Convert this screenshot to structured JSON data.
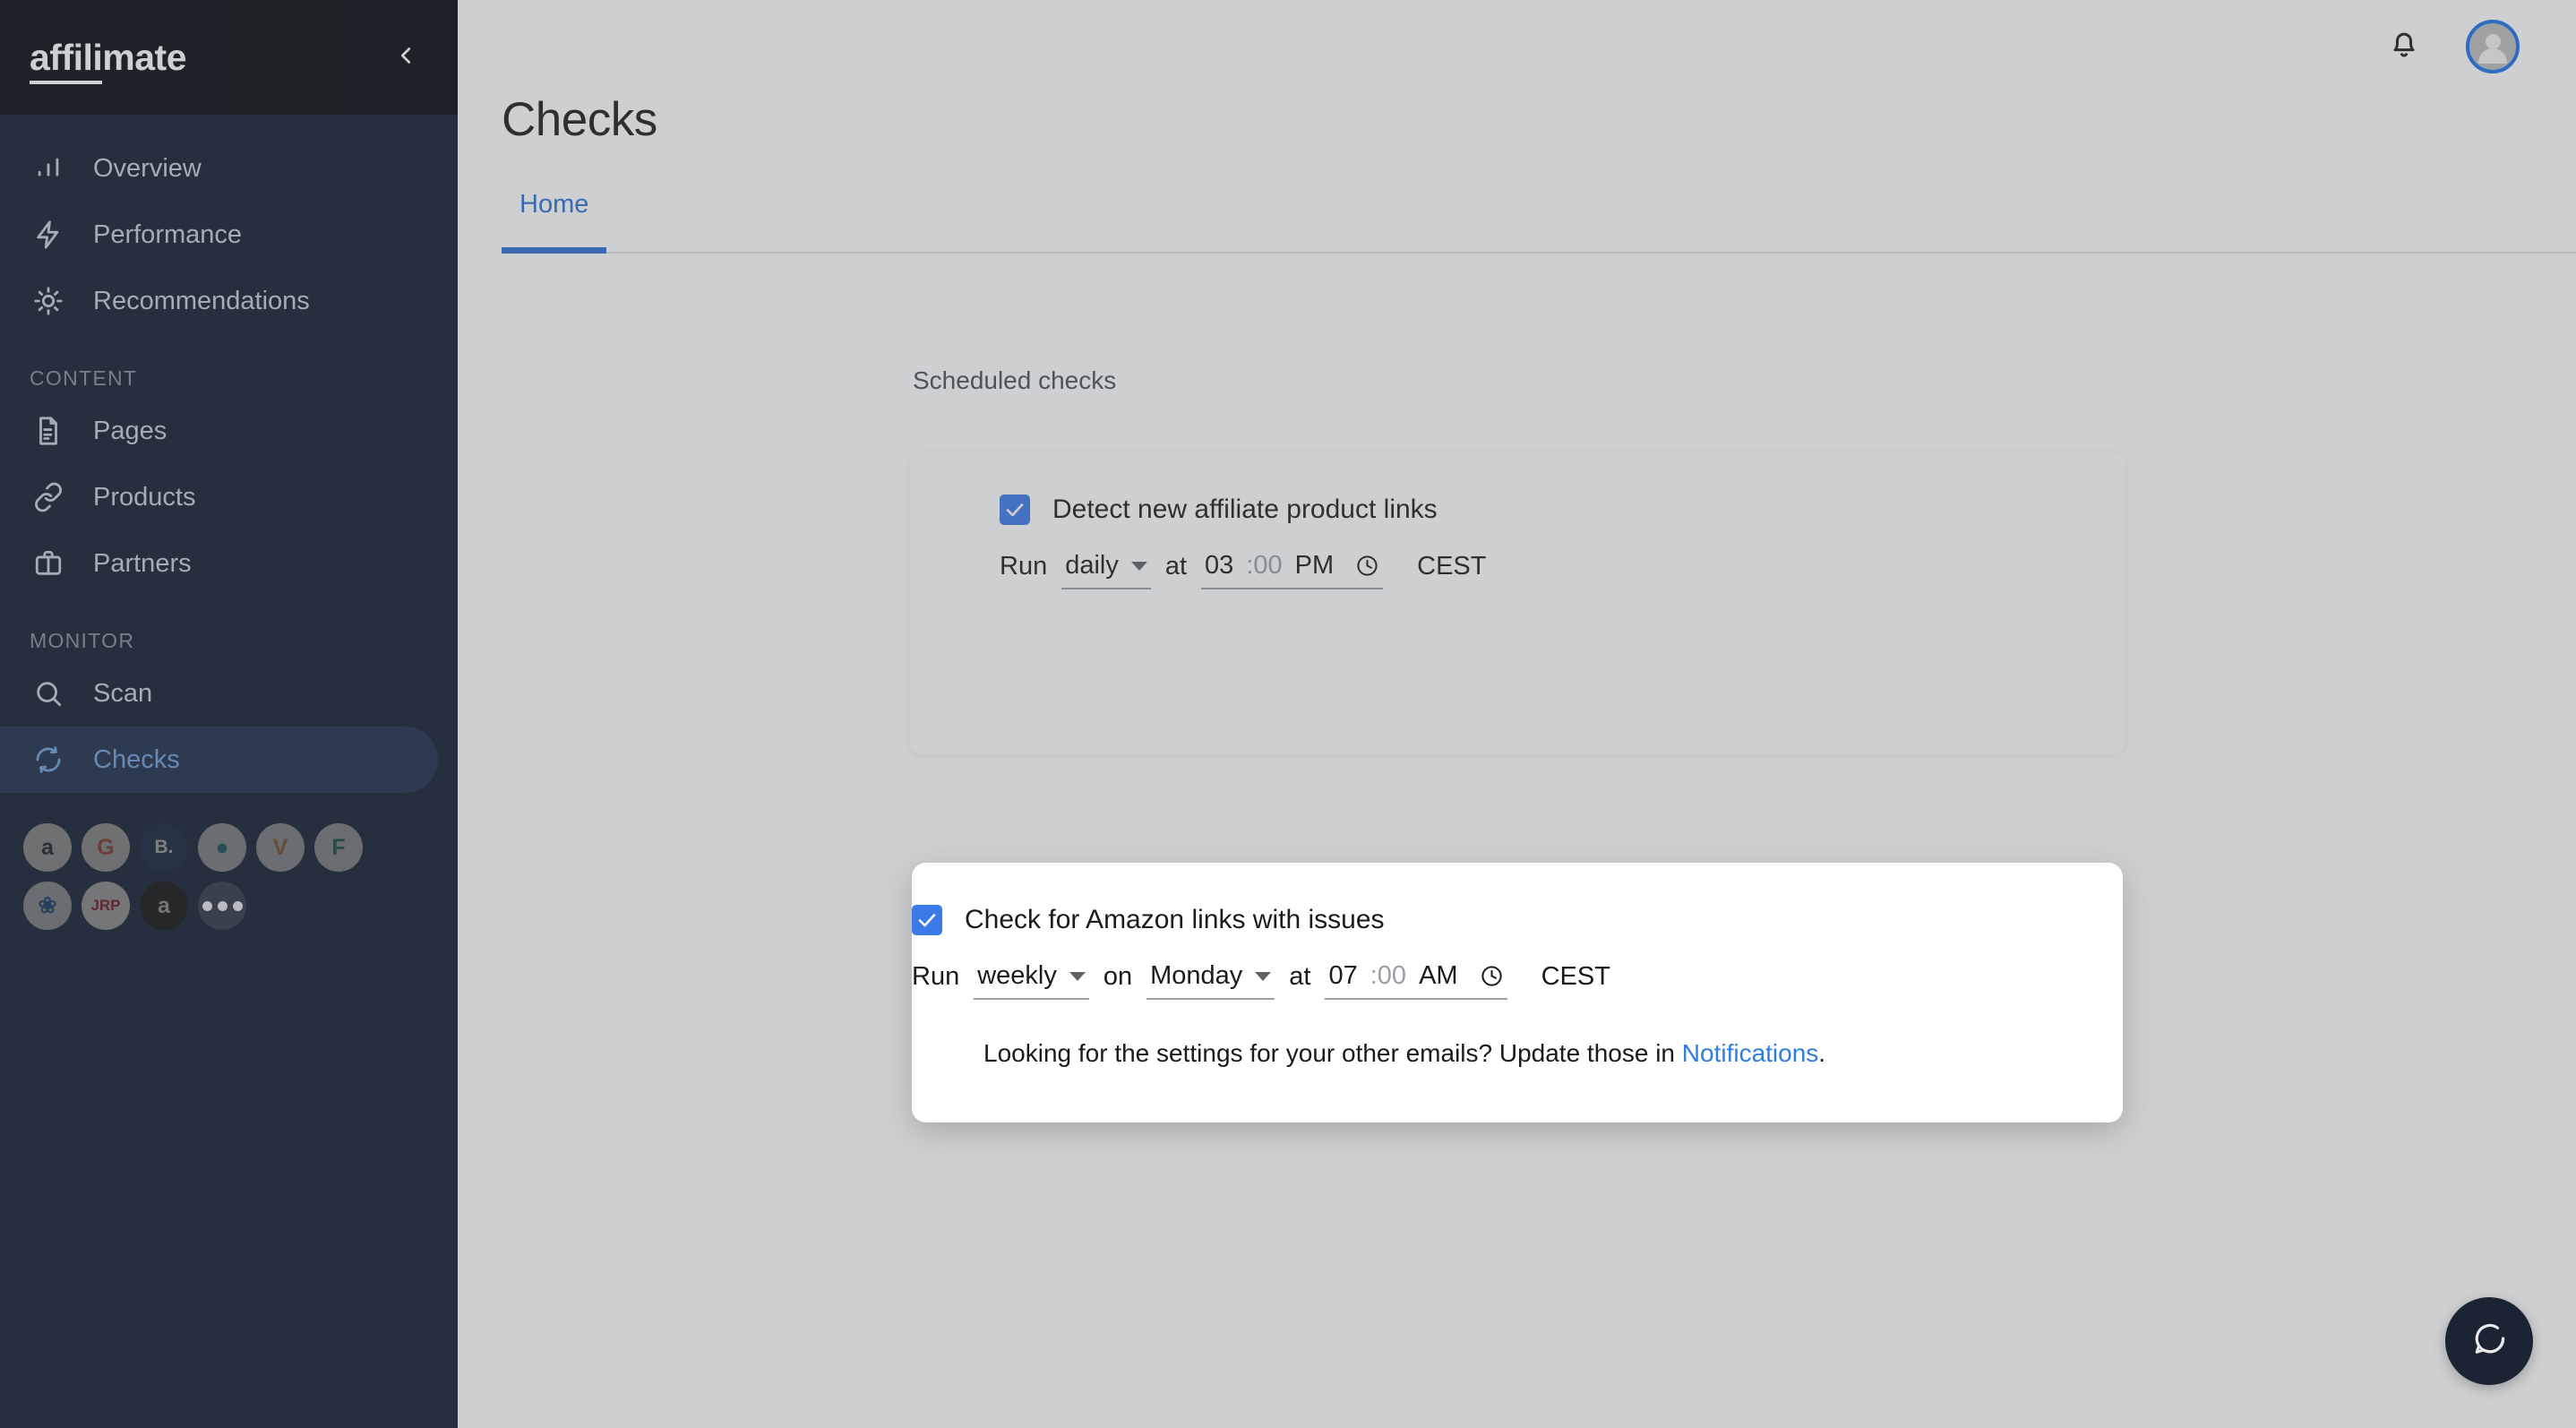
{
  "brand": {
    "name_bold": "affili",
    "name_rest": "mate"
  },
  "colors": {
    "accent": "#2f6fd0",
    "sidebar_bg": "#101a2b",
    "sidebar_header_bg": "#05070c",
    "active_bg": "#1b2a46",
    "active_text": "#6e9bd6",
    "checkbox": "#3b7ae8",
    "link": "#2f7de1"
  },
  "sidebar": {
    "collapse_icon": "chevron-left-icon",
    "items": [
      {
        "label": "Overview",
        "icon": "bar-chart-icon",
        "active": false
      },
      {
        "label": "Performance",
        "icon": "lightning-bolt-icon",
        "active": false
      },
      {
        "label": "Recommendations",
        "icon": "sun-sparkle-icon",
        "active": false
      }
    ],
    "sections": [
      {
        "title": "CONTENT",
        "items": [
          {
            "label": "Pages",
            "icon": "document-icon",
            "active": false
          },
          {
            "label": "Products",
            "icon": "link-icon",
            "active": false
          },
          {
            "label": "Partners",
            "icon": "briefcase-icon",
            "active": false
          }
        ]
      },
      {
        "title": "MONITOR",
        "items": [
          {
            "label": "Scan",
            "icon": "magnifier-icon",
            "active": false
          },
          {
            "label": "Checks",
            "icon": "refresh-sync-icon",
            "active": true
          }
        ]
      }
    ],
    "partners": [
      {
        "name": "amazon",
        "glyph": "a",
        "bg": "#d8d8d8",
        "fg": "#232f3e"
      },
      {
        "name": "getyourguide",
        "glyph": "G",
        "bg": "#d8d8d8",
        "fg": "#e0503a"
      },
      {
        "name": "booking",
        "glyph": "B.",
        "bg": "#1b3a6b",
        "fg": "#ffffff"
      },
      {
        "name": "partner-teal",
        "glyph": "●",
        "bg": "#cfd4da",
        "fg": "#19808c"
      },
      {
        "name": "viator",
        "glyph": "V",
        "bg": "#cfd4da",
        "fg": "#c97c1f"
      },
      {
        "name": "partner-f",
        "glyph": "F",
        "bg": "#cfd4da",
        "fg": "#1f7a5a"
      },
      {
        "name": "partner-cart",
        "glyph": "❀",
        "bg": "#cfd4da",
        "fg": "#1b5fa8"
      },
      {
        "name": "jrp",
        "glyph": "JRP",
        "bg": "#e8e8e8",
        "fg": "#c2172c"
      },
      {
        "name": "amazon-dark",
        "glyph": "a",
        "bg": "#1b1b1b",
        "fg": "#e8e8e8"
      },
      {
        "name": "more",
        "glyph": "•••",
        "bg": "#2a3443",
        "fg": "#e3e6eb"
      }
    ]
  },
  "topbar": {
    "bell_icon": "bell-icon",
    "avatar_icon": "user-avatar-icon"
  },
  "page": {
    "title": "Checks"
  },
  "tabs": [
    {
      "label": "Home",
      "active": true
    }
  ],
  "content": {
    "section_label": "Scheduled checks",
    "checks": [
      {
        "title": "Detect new affiliate product links",
        "checked": true,
        "run_word": "Run",
        "frequency": "daily",
        "on_word": "",
        "day": "",
        "at_word": "at",
        "hour": "03",
        "minute": ":00",
        "meridiem": "PM",
        "clock_icon": "clock-icon",
        "timezone": "CEST"
      },
      {
        "title": "Check for Amazon links with issues",
        "checked": true,
        "run_word": "Run",
        "frequency": "weekly",
        "on_word": "on",
        "day": "Monday",
        "at_word": "at",
        "hour": "07",
        "minute": ":00",
        "meridiem": "AM",
        "clock_icon": "clock-icon",
        "timezone": "CEST"
      }
    ],
    "footnote": {
      "text_before": "Looking for the settings for your other emails? Update those in ",
      "link_text": "Notifications",
      "text_after": "."
    }
  },
  "help_button": {
    "icon": "chat-bubble-icon"
  }
}
